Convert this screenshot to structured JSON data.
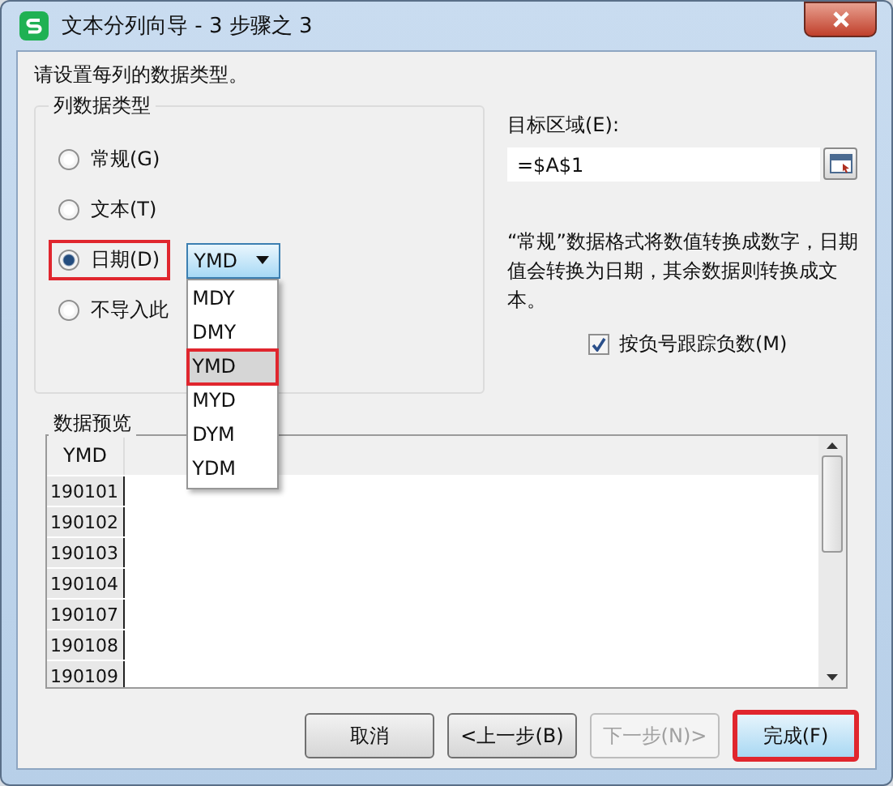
{
  "window": {
    "title": "文本分列向导 - 3 步骤之 3"
  },
  "instruction": "请设置每列的数据类型。",
  "column_type": {
    "title": "列数据类型",
    "options": [
      {
        "label": "常规(G)",
        "selected": false,
        "highlighted": false
      },
      {
        "label": "文本(T)",
        "selected": false,
        "highlighted": false
      },
      {
        "label": "日期(D)",
        "selected": true,
        "highlighted": true
      },
      {
        "label": "不导入此",
        "selected": false,
        "highlighted": false
      }
    ],
    "date_format": {
      "value": "YMD",
      "expanded": true,
      "items": [
        {
          "label": "MDY",
          "selected": false,
          "highlighted": false
        },
        {
          "label": "DMY",
          "selected": false,
          "highlighted": false
        },
        {
          "label": "YMD",
          "selected": true,
          "highlighted": true
        },
        {
          "label": "MYD",
          "selected": false,
          "highlighted": false
        },
        {
          "label": "DYM",
          "selected": false,
          "highlighted": false
        },
        {
          "label": "YDM",
          "selected": false,
          "highlighted": false
        }
      ]
    }
  },
  "destination": {
    "label": "目标区域(E):",
    "value": "=$A$1"
  },
  "description": "“常规”数据格式将数值转换成数字，日期值会转换为日期，其余数据则转换成文本。",
  "negative_checkbox": {
    "label": "按负号跟踪负数(M)",
    "checked": true
  },
  "preview": {
    "title": "数据预览",
    "header": "YMD",
    "rows": [
      "190101",
      "190102",
      "190103",
      "190104",
      "190107",
      "190108",
      "190109"
    ]
  },
  "buttons": [
    {
      "label": "取消",
      "disabled": false,
      "highlighted": false
    },
    {
      "label": "<上一步(B)",
      "disabled": false,
      "highlighted": false
    },
    {
      "label": "下一步(N)>",
      "disabled": true,
      "highlighted": false
    },
    {
      "label": "完成(F)",
      "disabled": false,
      "highlighted": true
    }
  ]
}
